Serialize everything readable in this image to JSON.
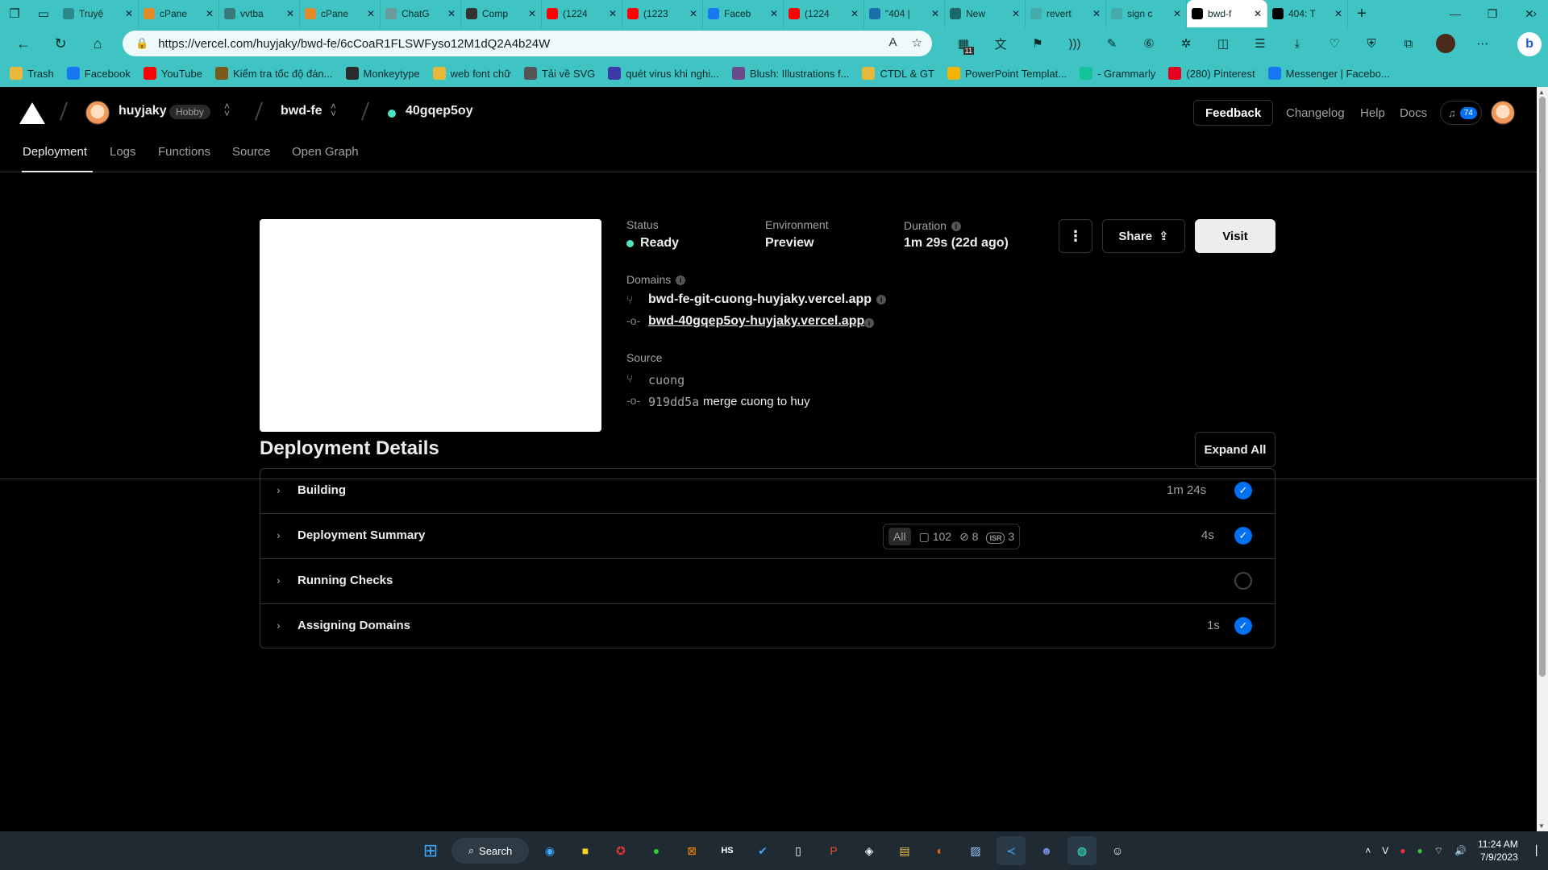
{
  "browser": {
    "tabs": [
      {
        "label": "Truyệ",
        "color": "#2a8a8a"
      },
      {
        "label": "cPane",
        "color": "#e08a2a"
      },
      {
        "label": "vvtba",
        "color": "#3a7a7a"
      },
      {
        "label": "cPane",
        "color": "#e08a2a"
      },
      {
        "label": "ChatG",
        "color": "#6a9a9a"
      },
      {
        "label": "Comp",
        "color": "#333333"
      },
      {
        "label": "(1224",
        "color": "#ff0000"
      },
      {
        "label": "(1223",
        "color": "#ff0000"
      },
      {
        "label": "Faceb",
        "color": "#1877f2"
      },
      {
        "label": "(1224",
        "color": "#ff0000"
      },
      {
        "label": "\"404 |",
        "color": "#1a6fa8"
      },
      {
        "label": "New",
        "color": "#1a6a6a"
      },
      {
        "label": "revert",
        "color": "#4aa"
      },
      {
        "label": "sign c",
        "color": "#4aa"
      },
      {
        "label": "bwd-f",
        "color": "#000000"
      },
      {
        "label": "404: T",
        "color": "#000000"
      }
    ],
    "active_tab_index": 14,
    "url": "https://vercel.com/huyjaky/bwd-fe/6cCoaR1FLSWFyso12M1dQ2A4b24W",
    "ext_badge": "11",
    "bookmarks": [
      {
        "label": "Trash",
        "icon": "folder-icon",
        "color": "#e8b83a"
      },
      {
        "label": "Facebook",
        "icon": "facebook-icon",
        "color": "#1877f2"
      },
      {
        "label": "YouTube",
        "icon": "youtube-icon",
        "color": "#ff0000"
      },
      {
        "label": "Kiểm tra tốc độ đán...",
        "icon": "speed-icon",
        "color": "#7a5a1a"
      },
      {
        "label": "Monkeytype",
        "icon": "monkeytype-icon",
        "color": "#2a2a2a"
      },
      {
        "label": "web font chữ",
        "icon": "folder-icon",
        "color": "#e8b83a"
      },
      {
        "label": "Tải về SVG",
        "icon": "file-icon",
        "color": "#555555"
      },
      {
        "label": "quét virus khi nghi...",
        "icon": "virustotal-icon",
        "color": "#3a3aa8"
      },
      {
        "label": "Blush: Illustrations f...",
        "icon": "blush-icon",
        "color": "#6a4a8a"
      },
      {
        "label": "CTDL & GT",
        "icon": "folder-icon",
        "color": "#e8b83a"
      },
      {
        "label": "PowerPoint Templat...",
        "icon": "gdrive-icon",
        "color": "#f4b400"
      },
      {
        "label": "- Grammarly",
        "icon": "grammarly-icon",
        "color": "#15c39a"
      },
      {
        "label": "(280) Pinterest",
        "icon": "pinterest-icon",
        "color": "#e60023"
      },
      {
        "label": "Messenger | Facebo...",
        "icon": "facebook-icon",
        "color": "#1877f2"
      }
    ]
  },
  "vercel": {
    "team": "huyjaky",
    "plan": "Hobby",
    "project": "bwd-fe",
    "deployment_id": "40gqep5oy",
    "top_actions": {
      "feedback": "Feedback",
      "changelog": "Changelog",
      "help": "Help",
      "docs": "Docs"
    },
    "notifications": "74",
    "tabs": [
      "Deployment",
      "Logs",
      "Functions",
      "Source",
      "Open Graph"
    ],
    "status_label": "Status",
    "status_value": "Ready",
    "environment_label": "Environment",
    "environment_value": "Preview",
    "duration_label": "Duration",
    "duration_value": "1m 29s (22d ago)",
    "share_label": "Share",
    "visit_label": "Visit",
    "domains_label": "Domains",
    "domains": [
      "bwd-fe-git-cuong-huyjaky.vercel.app",
      "bwd-40gqep5oy-huyjaky.vercel.app"
    ],
    "source_label": "Source",
    "branch": "cuong",
    "commit_hash": "919dd5a",
    "commit_message": "merge cuong to huy",
    "details_title": "Deployment Details",
    "expand_all": "Expand All",
    "steps": [
      {
        "name": "Building",
        "time": "1m 24s",
        "done": true
      },
      {
        "name": "Deployment Summary",
        "time": "4s",
        "done": true
      },
      {
        "name": "Running Checks",
        "time": "",
        "done": false
      },
      {
        "name": "Assigning Domains",
        "time": "1s",
        "done": true
      }
    ],
    "summary_filters": {
      "all": "All",
      "files": "102",
      "functions": "8",
      "isr_label": "ISR",
      "isr": "3"
    }
  },
  "taskbar": {
    "search_label": "Search",
    "time": "11:24 AM",
    "date": "7/9/2023"
  }
}
